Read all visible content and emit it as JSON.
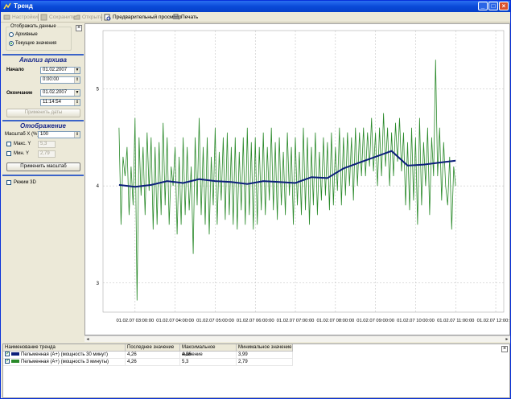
{
  "window": {
    "title": "Тренд",
    "controls": [
      "_",
      "□",
      "×"
    ]
  },
  "toolbar": {
    "settings": "Настройки",
    "save": "Сохранить",
    "open": "Открыть",
    "preview": "Предварительный просмотр",
    "print": "Печать"
  },
  "left_panel": {
    "display_group": {
      "title": "Отображать данные",
      "options": [
        "Архивные",
        "Текущие значения"
      ],
      "selected": "Текущие значения"
    },
    "archive": {
      "title": "Анализ архива",
      "start_label": "Начало",
      "start_date": "01.02.2007",
      "start_time": "0:00:00",
      "end_label": "Окончание",
      "end_date": "01.02.2007",
      "end_time": "11:14:54",
      "apply_button": "Применить даты"
    },
    "display": {
      "title": "Отображение",
      "scale_label": "Масштаб X (%)",
      "scale_value": "100",
      "max_y_label": "Макс. Y",
      "max_y_value": "5,3",
      "min_y_label": "Мин. Y",
      "min_y_value": "2,79",
      "apply_button": "Применить масштаб"
    },
    "mode_3d": "Режим 3D"
  },
  "chart_data": {
    "type": "line",
    "ylim": [
      2.7,
      5.6
    ],
    "yticks": [
      "5",
      "4",
      "3"
    ],
    "x_categories": [
      "01.02.07 03:00:00",
      "01.02.07 04:00:00",
      "01.02.07 05:00:00",
      "01.02.07 06:00:00",
      "01.02.07 07:00:00",
      "01.02.07 08:00:00",
      "01.02.07 09:00:00",
      "01.02.07 10:00:00",
      "01.02.07 11:00:00",
      "01.02.07 12:00:00"
    ],
    "grid": true,
    "series": [
      {
        "name": "Пельменная (A+) (мощность 30 минут)",
        "color": "#0c1f7a",
        "x": [
          2.6,
          3.0,
          3.4,
          3.8,
          4.2,
          4.6,
          5.0,
          5.4,
          5.8,
          6.2,
          6.6,
          7.0,
          7.4,
          7.8,
          8.2,
          8.6,
          9.0,
          9.4,
          9.8,
          10.2,
          10.6,
          11.0
        ],
        "values": [
          4.01,
          3.99,
          4.01,
          4.05,
          4.03,
          4.07,
          4.05,
          4.04,
          4.02,
          4.05,
          4.04,
          4.03,
          4.09,
          4.08,
          4.18,
          4.24,
          4.3,
          4.36,
          4.21,
          4.22,
          4.24,
          4.26
        ]
      },
      {
        "name": "Пельменная (A+) (мощность 3 минуты)",
        "color": "#2a8a2a",
        "x": [
          2.6,
          2.65,
          2.7,
          2.75,
          2.8,
          2.85,
          2.9,
          2.95,
          3.0,
          3.05,
          3.1,
          3.15,
          3.2,
          3.25,
          3.3,
          3.35,
          3.4,
          3.45,
          3.5,
          3.55,
          3.6,
          3.65,
          3.7,
          3.75,
          3.8,
          3.85,
          3.9,
          3.95,
          4.0,
          4.05,
          4.1,
          4.15,
          4.2,
          4.25,
          4.3,
          4.35,
          4.4,
          4.45,
          4.5,
          4.55,
          4.6,
          4.65,
          4.7,
          4.75,
          4.8,
          4.85,
          4.9,
          4.95,
          5.0,
          5.05,
          5.1,
          5.15,
          5.2,
          5.25,
          5.3,
          5.35,
          5.4,
          5.45,
          5.5,
          5.55,
          5.6,
          5.65,
          5.7,
          5.75,
          5.8,
          5.85,
          5.9,
          5.95,
          6.0,
          6.05,
          6.1,
          6.15,
          6.2,
          6.25,
          6.3,
          6.35,
          6.4,
          6.45,
          6.5,
          6.55,
          6.6,
          6.65,
          6.7,
          6.75,
          6.8,
          6.85,
          6.9,
          6.95,
          7.0,
          7.05,
          7.1,
          7.15,
          7.2,
          7.25,
          7.3,
          7.35,
          7.4,
          7.45,
          7.5,
          7.55,
          7.6,
          7.65,
          7.7,
          7.75,
          7.8,
          7.85,
          7.9,
          7.95,
          8.0,
          8.05,
          8.1,
          8.15,
          8.2,
          8.25,
          8.3,
          8.35,
          8.4,
          8.45,
          8.5,
          8.55,
          8.6,
          8.65,
          8.7,
          8.75,
          8.8,
          8.85,
          8.9,
          8.95,
          9.0,
          9.05,
          9.1,
          9.15,
          9.2,
          9.25,
          9.3,
          9.35,
          9.4,
          9.45,
          9.5,
          9.55,
          9.6,
          9.65,
          9.7,
          9.75,
          9.8,
          9.85,
          9.9,
          9.95,
          10.0,
          10.05,
          10.1,
          10.15,
          10.2,
          10.25,
          10.3,
          10.35,
          10.4,
          10.45,
          10.5,
          10.55,
          10.6,
          10.65,
          10.7,
          10.75,
          10.8,
          10.85,
          10.9,
          10.95,
          11.0
        ],
        "values": [
          4.6,
          3.6,
          4.3,
          4.1,
          4.4,
          3.7,
          4.2,
          3.8,
          4.7,
          2.82,
          4.5,
          3.9,
          4.4,
          3.7,
          4.55,
          3.95,
          4.5,
          3.55,
          4.4,
          3.6,
          4.45,
          3.7,
          4.65,
          3.8,
          4.5,
          3.6,
          4.2,
          4.0,
          4.4,
          3.5,
          4.3,
          3.6,
          4.5,
          3.7,
          4.4,
          3.75,
          4.2,
          3.3,
          4.5,
          3.8,
          4.7,
          3.7,
          4.4,
          3.6,
          4.5,
          3.5,
          4.3,
          3.8,
          4.6,
          3.6,
          4.35,
          3.85,
          4.5,
          3.65,
          4.55,
          3.7,
          4.4,
          3.6,
          4.5,
          3.55,
          4.35,
          3.75,
          4.5,
          3.6,
          4.6,
          3.7,
          4.45,
          3.55,
          4.5,
          3.6,
          4.4,
          3.75,
          4.55,
          3.7,
          4.4,
          3.85,
          4.6,
          3.75,
          4.45,
          3.65,
          4.5,
          3.8,
          4.35,
          3.7,
          4.55,
          3.9,
          4.4,
          3.6,
          4.5,
          3.8,
          4.35,
          3.7,
          4.6,
          3.75,
          4.5,
          3.6,
          4.4,
          3.8,
          4.55,
          3.7,
          4.35,
          3.85,
          4.5,
          3.9,
          4.45,
          3.75,
          4.55,
          3.8,
          4.4,
          3.95,
          4.6,
          3.8,
          4.5,
          3.9,
          4.55,
          4.0,
          4.5,
          3.85,
          4.6,
          4.0,
          4.55,
          4.1,
          4.6,
          4.1,
          4.55,
          4.2,
          4.7,
          4.15,
          4.55,
          4.0,
          4.6,
          4.1,
          4.75,
          4.2,
          4.6,
          4.0,
          4.55,
          4.1,
          4.65,
          4.25,
          4.7,
          4.15,
          4.55,
          3.8,
          4.45,
          3.75,
          4.6,
          3.85,
          4.5,
          3.6,
          4.7,
          3.8,
          4.45,
          4.0,
          4.6,
          3.7,
          4.5,
          4.1,
          5.3,
          4.1,
          4.6,
          3.85,
          4.45,
          4.0,
          3.8,
          4.3,
          3.55,
          4.2,
          4.0
        ]
      }
    ]
  },
  "table": {
    "headers": [
      "Наименование тренда",
      "Последнее значение",
      "Максимальное значение",
      "Минимальное значение"
    ],
    "rows": [
      {
        "name": "Пельменная (A+) (мощность 30 минут)",
        "last": "4,26",
        "max": "4,36",
        "min": "3,99",
        "color": "#0c1f7a"
      },
      {
        "name": "Пельменная (A+) (мощность 3 минуты)",
        "last": "4,26",
        "max": "5,3",
        "min": "2,79",
        "color": "#2a8a2a"
      }
    ]
  }
}
